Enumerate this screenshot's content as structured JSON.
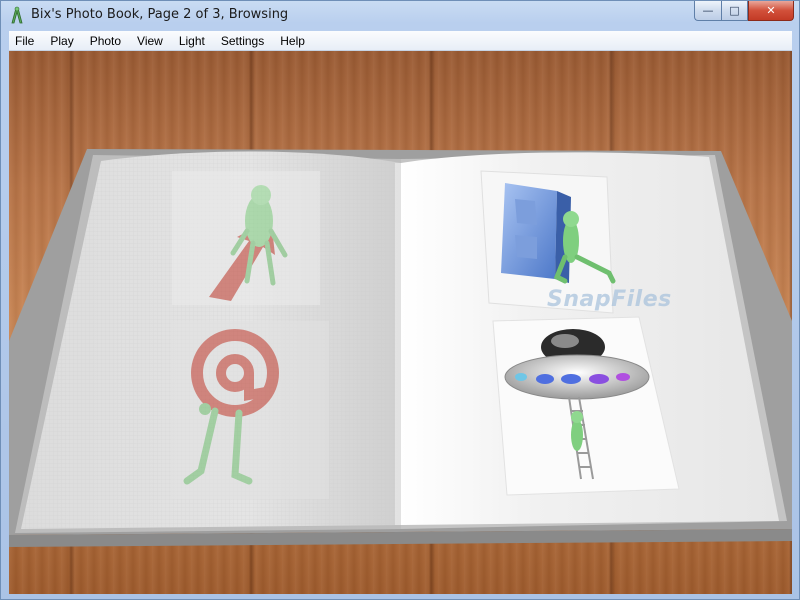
{
  "window": {
    "title": "Bix's Photo Book, Page 2 of 3, Browsing",
    "controls": {
      "minimize": "—",
      "maximize": "□",
      "close": "✕"
    }
  },
  "menu": {
    "items": [
      {
        "label": "File"
      },
      {
        "label": "Play"
      },
      {
        "label": "Photo"
      },
      {
        "label": "View"
      },
      {
        "label": "Light"
      },
      {
        "label": "Settings"
      },
      {
        "label": "Help"
      }
    ]
  },
  "book": {
    "watermark": "SnapFiles",
    "photos": [
      {
        "name": "green-figure-on-red-arrow",
        "page": "left"
      },
      {
        "name": "green-figure-holding-at-sign",
        "page": "left"
      },
      {
        "name": "green-figure-leaning-on-blue-b",
        "page": "right"
      },
      {
        "name": "green-figure-climbing-ladder-to-ufo",
        "page": "right"
      }
    ]
  },
  "colors": {
    "title_bar": "#b9cfee",
    "close_button": "#c33b26",
    "wood": "#b87447"
  }
}
